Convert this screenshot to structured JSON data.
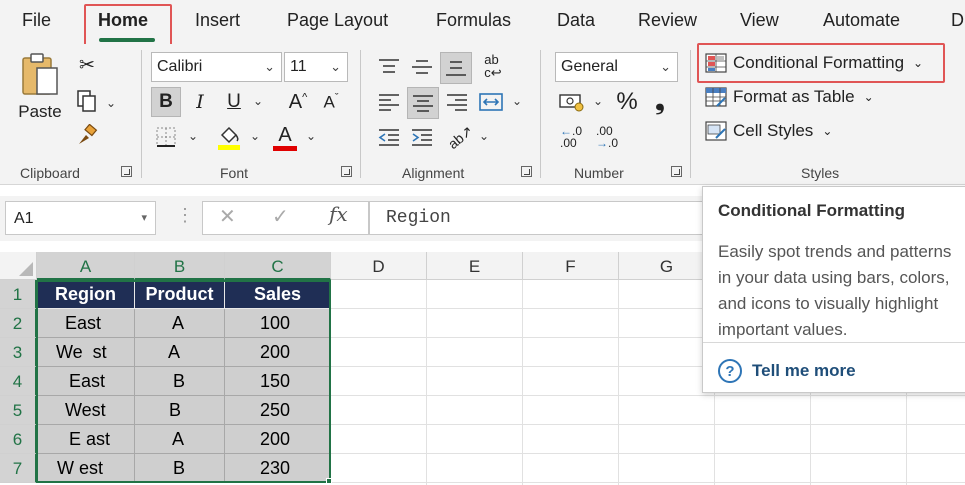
{
  "tabs": [
    {
      "label": "File"
    },
    {
      "label": "Home"
    },
    {
      "label": "Insert"
    },
    {
      "label": "Page Layout"
    },
    {
      "label": "Formulas"
    },
    {
      "label": "Data"
    },
    {
      "label": "Review"
    },
    {
      "label": "View"
    },
    {
      "label": "Automate"
    },
    {
      "label": "D"
    }
  ],
  "ribbon": {
    "clipboard": {
      "label": "Clipboard",
      "paste": "Paste"
    },
    "font": {
      "label": "Font",
      "name": "Calibri",
      "size": "11"
    },
    "alignment": {
      "label": "Alignment"
    },
    "number": {
      "label": "Number",
      "format": "General"
    },
    "styles": {
      "label": "Styles",
      "conditional_formatting": "Conditional Formatting",
      "format_as_table": "Format as Table",
      "cell_styles": "Cell Styles"
    }
  },
  "formula_bar": {
    "name_box": "A1",
    "fx": "fx",
    "content": "Region"
  },
  "columns": [
    "A",
    "B",
    "C",
    "D",
    "E",
    "F",
    "G"
  ],
  "rows": [
    "1",
    "2",
    "3",
    "4",
    "5",
    "6",
    "7"
  ],
  "table": {
    "headers": [
      "Region",
      "Product",
      "Sales"
    ],
    "rows": [
      [
        "East",
        "A",
        "100"
      ],
      [
        "We  st",
        "A",
        "200"
      ],
      [
        "East",
        "B",
        "150"
      ],
      [
        "West",
        "B",
        "250"
      ],
      [
        "E ast",
        "A",
        "200"
      ],
      [
        "W est",
        "B",
        "230"
      ]
    ]
  },
  "tooltip": {
    "title": "Conditional Formatting",
    "body": "Easily spot trends and patterns in your data using bars, colors, and icons to visually highlight important values.",
    "link": "Tell me more"
  },
  "colors": {
    "accent_green": "#217346",
    "header_fill": "#1f2e55",
    "highlight_red": "#e05555"
  }
}
